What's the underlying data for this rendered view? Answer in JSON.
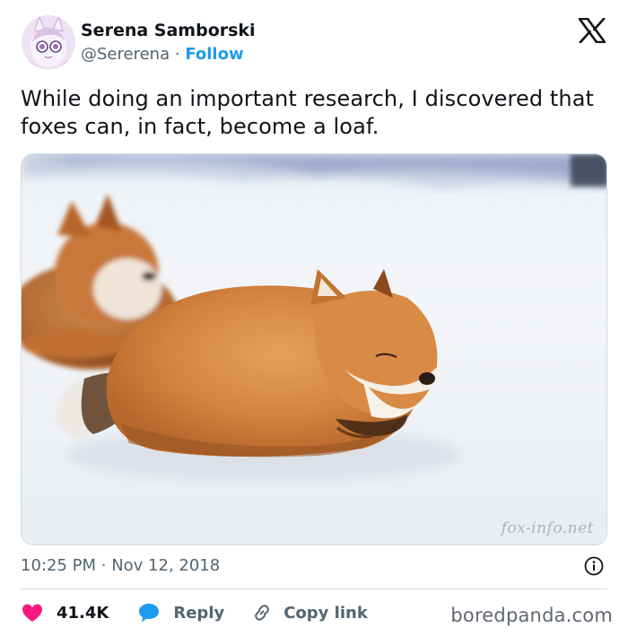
{
  "author": {
    "display_name": "Serena Samborski",
    "handle": "@Sererena",
    "separator": "·",
    "follow_label": "Follow"
  },
  "tweet": {
    "text": "While doing an important research, I discovered that foxes can, in fact, become a loaf."
  },
  "media": {
    "watermark": "fox-info.net"
  },
  "meta": {
    "time": "10:25 PM",
    "separator": "·",
    "date": "Nov 12, 2018"
  },
  "actions": {
    "like_count": "41.4K",
    "reply_label": "Reply",
    "copy_link_label": "Copy link"
  },
  "footer": {
    "brand": "boredpanda.com"
  },
  "colors": {
    "accent": "#1d9bf0",
    "like": "#f91880",
    "text": "#0f1419",
    "muted": "#536471"
  },
  "icons": {
    "logo": "x-logo-icon",
    "info": "info-icon",
    "like": "heart-icon",
    "reply": "speech-bubble-icon",
    "copy": "link-icon"
  }
}
